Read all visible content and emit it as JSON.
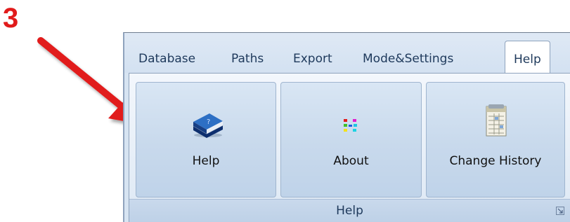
{
  "annotation": {
    "step_number": "3",
    "arrow_color": "#e11b1b"
  },
  "tabs": [
    {
      "label": "Database",
      "active": false
    },
    {
      "label": "Paths",
      "active": false
    },
    {
      "label": "Export",
      "active": false
    },
    {
      "label": "Mode&Settings",
      "active": false
    },
    {
      "label": "Help",
      "active": true
    }
  ],
  "ribbon": {
    "buttons": [
      {
        "label": "Help",
        "icon": "help-book-icon"
      },
      {
        "label": "About",
        "icon": "about-icon"
      },
      {
        "label": "Change History",
        "icon": "change-history-icon"
      }
    ],
    "group_label": "Help",
    "launcher_icon": "dialog-launcher-icon"
  }
}
